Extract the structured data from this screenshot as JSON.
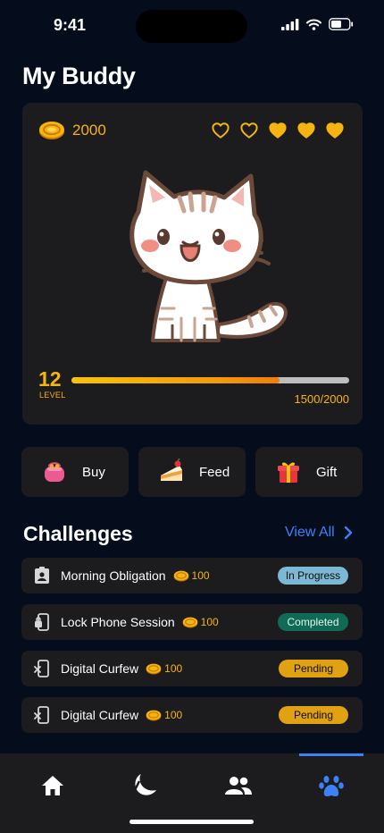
{
  "status": {
    "time": "9:41"
  },
  "title": "My Buddy",
  "buddy": {
    "coins": "2000",
    "hearts_filled": 3,
    "hearts_total": 5,
    "level": "12",
    "level_label": "LEVEL",
    "progress": 0.75,
    "xp_text": "1500/2000"
  },
  "actions": [
    {
      "label": "Buy",
      "icon": "purse-icon"
    },
    {
      "label": "Feed",
      "icon": "cake-icon"
    },
    {
      "label": "Gift",
      "icon": "gift-icon"
    }
  ],
  "challenges": {
    "title": "Challenges",
    "view_all": "View All",
    "items": [
      {
        "name": "Morning Obligation",
        "amount": "100",
        "status": "In Progress",
        "icon": "badge-icon"
      },
      {
        "name": "Lock Phone Session",
        "amount": "100",
        "status": "Completed",
        "icon": "phone-lock-icon"
      },
      {
        "name": "Digital Curfew",
        "amount": "100",
        "status": "Pending",
        "icon": "phone-off-icon"
      },
      {
        "name": "Digital Curfew",
        "amount": "100",
        "status": "Pending",
        "icon": "phone-off-icon"
      }
    ]
  },
  "tabs": [
    {
      "icon": "home-icon"
    },
    {
      "icon": "moon-icon"
    },
    {
      "icon": "friends-icon"
    },
    {
      "icon": "paw-icon",
      "active": true
    }
  ],
  "colors": {
    "accent": "#3c82f6",
    "coin": "#f6b40e",
    "in_progress": "#7ab8d4",
    "completed": "#0f6b55",
    "pending": "#e0a112"
  }
}
